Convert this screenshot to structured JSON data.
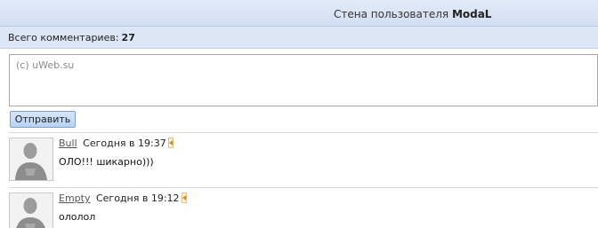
{
  "header": {
    "title_prefix": "Стена пользователя",
    "username": "ModaL"
  },
  "stats": {
    "label": "Всего комментариев:",
    "count": "27"
  },
  "form": {
    "placeholder": "(c) uWeb.su",
    "submit_label": "Отправить"
  },
  "comments": [
    {
      "author": "Bull",
      "time": "Сегодня в 19:37",
      "text": "ОЛО!!! шикарно)))",
      "avatar_icon": "user-silhouette-icon",
      "reply_icon": "reply-arrow-icon"
    },
    {
      "author": "Empty",
      "time": "Сегодня в 19:12",
      "text": "ололол",
      "avatar_icon": "user-silhouette-icon",
      "reply_icon": "reply-arrow-icon"
    }
  ],
  "colors": {
    "header_bg": "#d3def2",
    "stats_bg": "#dde6f5",
    "button_bg": "#b7d2f3",
    "reply_accent": "#e08a16"
  }
}
